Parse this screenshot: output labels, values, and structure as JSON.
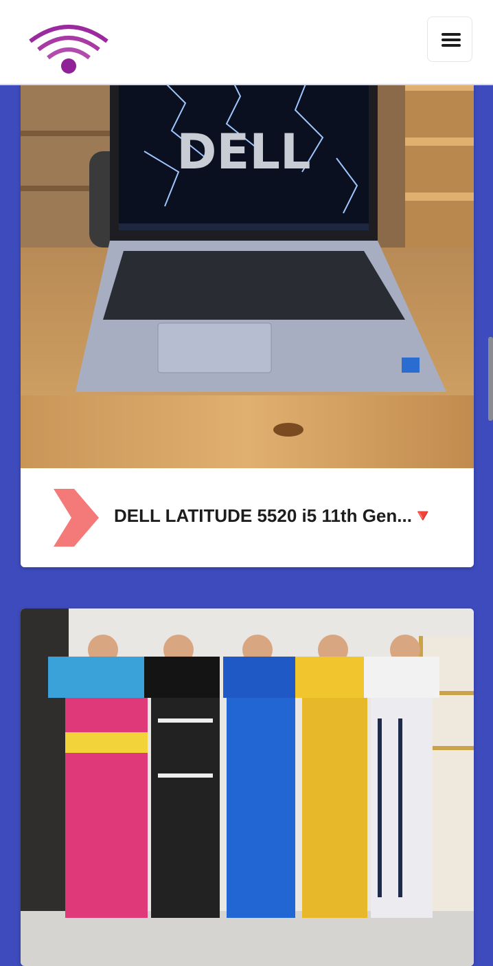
{
  "header": {
    "logo_icon": "wifi-signal-icon",
    "menu_icon": "hamburger-menu-icon",
    "colors": {
      "logo": "#9b2a9f",
      "background": "#ffffff"
    }
  },
  "page": {
    "background_color": "#3d4bbd"
  },
  "products": [
    {
      "title": "DELL LATITUDE 5520 i5 11th Gen...🔻",
      "image_description_icon": "laptop-photo",
      "footer_icon": "chevron-right-icon"
    },
    {
      "title": "",
      "image_description_icon": "jumpsuits-photo"
    }
  ]
}
